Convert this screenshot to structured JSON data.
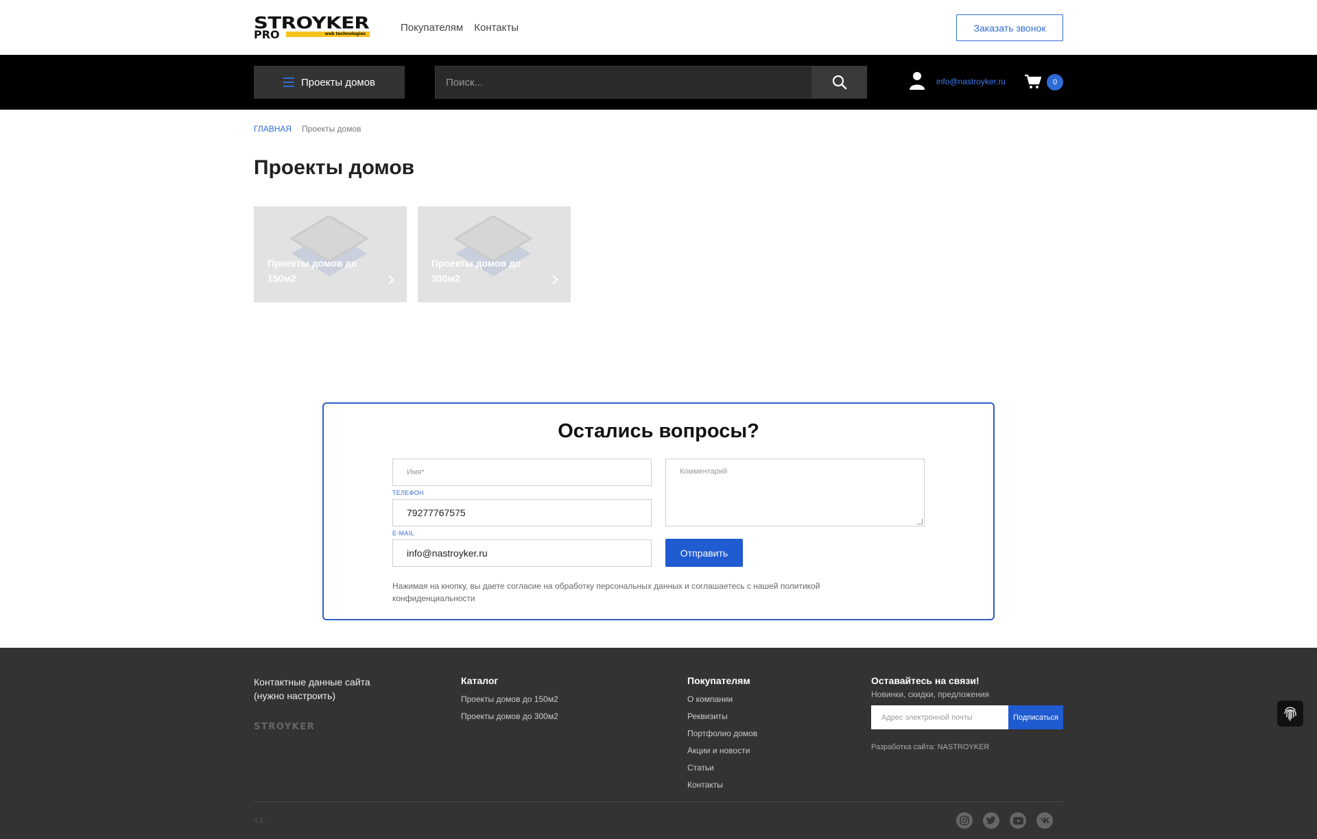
{
  "header": {
    "logo": {
      "line1": "STROYKER",
      "line2": "PRO",
      "tagline": "web technologies"
    },
    "nav": [
      "Покупателям",
      "Контакты"
    ],
    "callback_button": "Заказать звонок"
  },
  "toolbar": {
    "catalog_button": "Проекты домов",
    "search_placeholder": "Поиск...",
    "email": "info@nastroyker.ru",
    "cart_count": "0"
  },
  "breadcrumb": {
    "home": "ГЛАВНАЯ",
    "current": "Проекты домов"
  },
  "page_title": "Проекты домов",
  "categories": [
    {
      "label": "Проекты домов до 150м2"
    },
    {
      "label": "Проекты домов до 300м2"
    }
  ],
  "question_form": {
    "title": "Остались вопросы?",
    "name_placeholder": "Имя*",
    "phone_label": "ТЕЛЕФОН",
    "phone_value": "79277767575",
    "email_label": "E-MAIL",
    "email_value": "info@nastroyker.ru",
    "comment_placeholder": "Комментарий",
    "submit": "Отправить",
    "consent": "Нажимая на кнопку, вы даете согласие на обработку персональных данных и соглашаетесь с нашей политикой конфиденциальности"
  },
  "footer": {
    "contacts": "Контактные данные сайта (нужно настроить)",
    "logo": "STROYKER",
    "catalog": {
      "title": "Каталог",
      "links": [
        "Проекты домов до 150м2",
        "Проекты домов до 300м2"
      ]
    },
    "buyers": {
      "title": "Покупателям",
      "links": [
        "О компании",
        "Реквизиты",
        "Портфолио домов",
        "Акции и новости",
        "Статьи",
        "Контакты"
      ]
    },
    "subscribe": {
      "title": "Оставайтесь на связи!",
      "subtitle": "Новинки, скидки, предложения",
      "placeholder": "Адрес электронной почты",
      "button": "Подписаться"
    },
    "developer": "Разработка сайта: NASTROYKER",
    "version": "v.1.",
    "socials": [
      "instagram-icon",
      "twitter-icon",
      "youtube-icon",
      "vk-icon"
    ]
  },
  "colors": {
    "accent": "#2f6bd6",
    "dark": "#000000",
    "footer": "#333333",
    "logo_yellow": "#f6c21c"
  }
}
